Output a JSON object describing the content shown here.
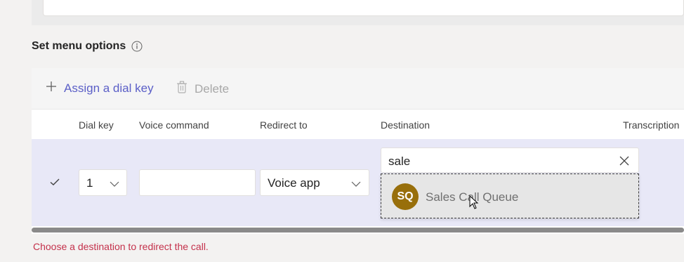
{
  "section": {
    "title": "Set menu options",
    "info_icon": "info-circle-icon"
  },
  "toolbar": {
    "assign_label": "Assign a dial key",
    "delete_label": "Delete"
  },
  "table": {
    "headers": {
      "dial_key": "Dial key",
      "voice_command": "Voice command",
      "redirect_to": "Redirect to",
      "destination": "Destination",
      "transcription": "Transcription"
    },
    "row": {
      "selected": true,
      "dial_key": "1",
      "voice_command": "",
      "redirect_to": "Voice app",
      "destination_query": "sale"
    }
  },
  "suggestion": {
    "initials": "SQ",
    "label": "Sales Call Queue",
    "avatar_color": "#986f0b"
  },
  "error": {
    "message": "Choose a destination to redirect the call."
  },
  "colors": {
    "accent": "#5b5fc7",
    "row_selected": "#e8e8f7",
    "error": "#c4314b"
  }
}
